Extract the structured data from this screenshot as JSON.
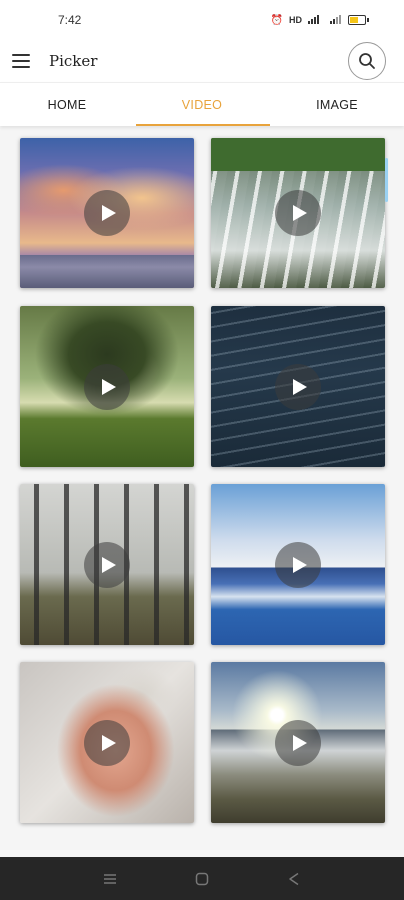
{
  "status_bar": {
    "time": "7:42",
    "indicators": "⏰ ≡ ∙∙",
    "battery_level": 0.5
  },
  "app_bar": {
    "title": "Picker",
    "menu_icon": "hamburger-menu-icon",
    "search_icon": "search-icon"
  },
  "tabs": [
    {
      "label": "HOME",
      "active": false
    },
    {
      "label": "VIDEO",
      "active": true
    },
    {
      "label": "IMAGE",
      "active": false
    }
  ],
  "accent_color": "#e8a33c",
  "videos": [
    {
      "thumbnail": "sunset-sky-over-sea"
    },
    {
      "thumbnail": "waterfall-aerial"
    },
    {
      "thumbnail": "tree-in-misty-forest"
    },
    {
      "thumbnail": "ocean-waves"
    },
    {
      "thumbnail": "foggy-forest"
    },
    {
      "thumbnail": "beach-waves"
    },
    {
      "thumbnail": "hand-with-sand"
    },
    {
      "thumbnail": "sunrise-over-fog"
    }
  ],
  "nav_bar": {
    "recents_icon": "recents-icon",
    "home_icon": "home-icon",
    "back_icon": "back-icon"
  }
}
